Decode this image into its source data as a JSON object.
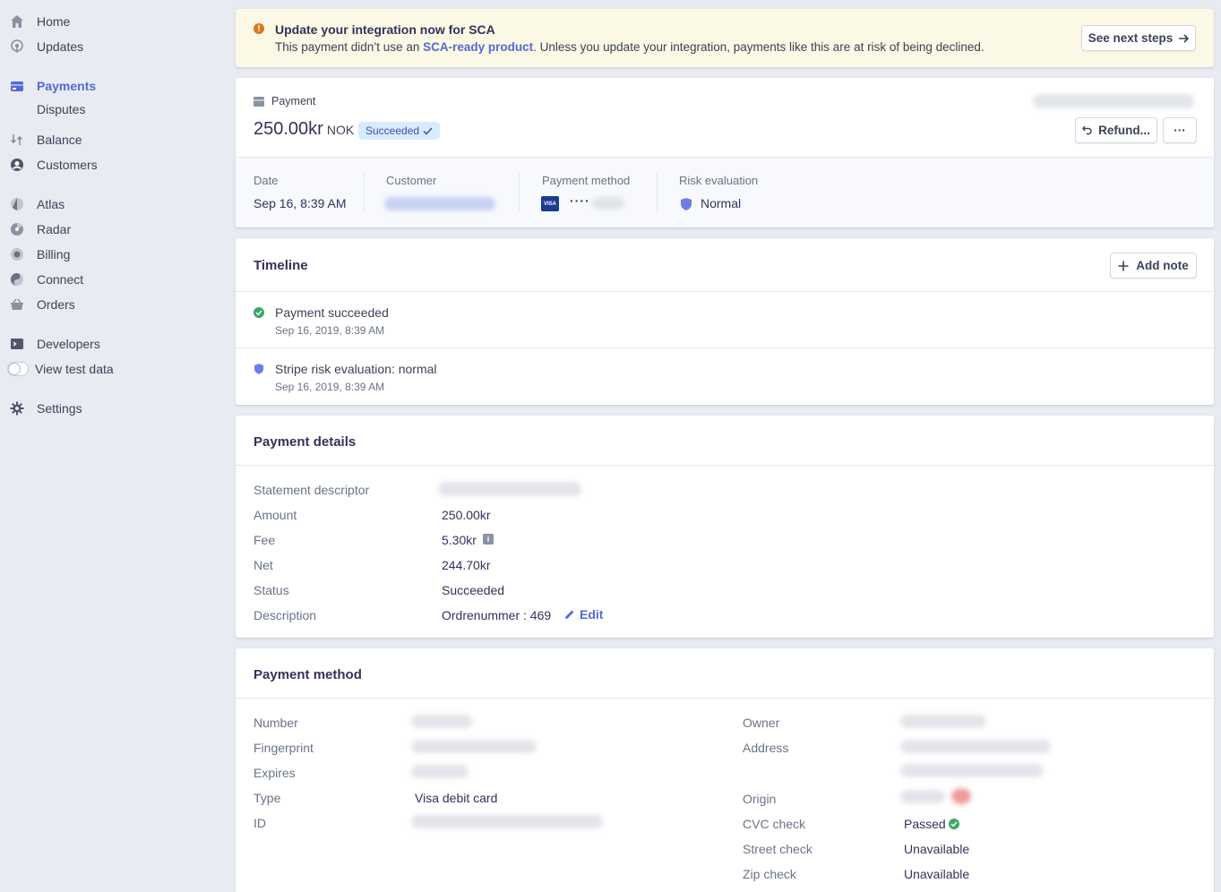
{
  "sidebar": {
    "home": "Home",
    "updates": "Updates",
    "payments": "Payments",
    "disputes": "Disputes",
    "balance": "Balance",
    "customers": "Customers",
    "atlas": "Atlas",
    "radar": "Radar",
    "billing": "Billing",
    "connect": "Connect",
    "orders": "Orders",
    "developers": "Developers",
    "view_test_data": "View test data",
    "settings": "Settings"
  },
  "banner": {
    "title": "Update your integration now for SCA",
    "text_before": "This payment didn’t use an ",
    "link": "SCA-ready product",
    "text_after": ". Unless you update your integration, payments like this are at risk of being declined.",
    "button": "See next steps"
  },
  "payment": {
    "kind": "Payment",
    "amount": "250.00kr",
    "currency": "NOK",
    "status": "Succeeded",
    "refund_button": "Refund...",
    "more_button": "···",
    "date_label": "Date",
    "date_value": "Sep 16, 8:39 AM",
    "customer_label": "Customer",
    "method_label": "Payment method",
    "card_brand": "VISA",
    "card_dots": "····",
    "risk_label": "Risk evaluation",
    "risk_value": "Normal"
  },
  "timeline": {
    "title": "Timeline",
    "add_note": "Add note",
    "items": [
      {
        "title": "Payment succeeded",
        "date": "Sep 16, 2019, 8:39 AM"
      },
      {
        "title": "Stripe risk evaluation: normal",
        "date": "Sep 16, 2019, 8:39 AM"
      }
    ]
  },
  "details": {
    "title": "Payment details",
    "rows": [
      {
        "label": "Statement descriptor",
        "value": ""
      },
      {
        "label": "Amount",
        "value": "250.00kr"
      },
      {
        "label": "Fee",
        "value": "5.30kr"
      },
      {
        "label": "Net",
        "value": "244.70kr"
      },
      {
        "label": "Status",
        "value": "Succeeded"
      },
      {
        "label": "Description",
        "value": "Ordrenummer : 469"
      }
    ],
    "edit": "Edit"
  },
  "method": {
    "title": "Payment method",
    "left": [
      {
        "label": "Number",
        "value": ""
      },
      {
        "label": "Fingerprint",
        "value": ""
      },
      {
        "label": "Expires",
        "value": ""
      },
      {
        "label": "Type",
        "value": "Visa debit card"
      },
      {
        "label": "ID",
        "value": ""
      }
    ],
    "right": [
      {
        "label": "Owner",
        "value": ""
      },
      {
        "label": "Address",
        "value": ""
      },
      {
        "label": "Origin",
        "value": ""
      },
      {
        "label": "CVC check",
        "value": "Passed"
      },
      {
        "label": "Street check",
        "value": "Unavailable"
      },
      {
        "label": "Zip check",
        "value": "Unavailable"
      }
    ]
  },
  "colors": {
    "accent": "#5469d4",
    "success": "#3ba86a",
    "warning": "#d97917"
  }
}
